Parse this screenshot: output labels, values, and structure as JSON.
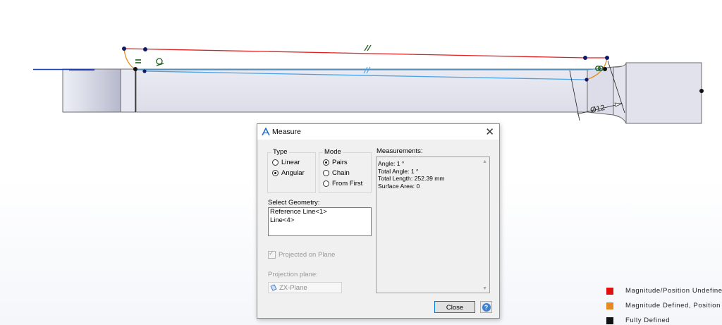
{
  "viewport": {
    "dimension_label": "Ø12",
    "colors": {
      "under_defined": "#e02020",
      "partially_defined": "#e58a20",
      "fully_defined": "#111111",
      "selected": "#4aa3e6",
      "reference_line": "#1f3fb0",
      "part_body": "#e4e5ee",
      "part_edge": "#555555"
    }
  },
  "dialog": {
    "title": "Measure",
    "title_icon": "measure-app-icon",
    "close_icon": "close-icon",
    "type_group": {
      "label": "Type",
      "options": [
        {
          "label": "Linear",
          "selected": false
        },
        {
          "label": "Angular",
          "selected": true
        }
      ]
    },
    "mode_group": {
      "label": "Mode",
      "options": [
        {
          "label": "Pairs",
          "selected": true
        },
        {
          "label": "Chain",
          "selected": false
        },
        {
          "label": "From First",
          "selected": false
        }
      ]
    },
    "select_geometry": {
      "label": "Select Geometry:",
      "items": [
        "Reference Line<1>",
        "Line<4>"
      ]
    },
    "projected_on_plane": {
      "label": "Projected on Plane",
      "checked": true,
      "enabled": false
    },
    "projection_plane": {
      "label": "Projection plane:",
      "value": "ZX-Plane",
      "icon": "plane-icon"
    },
    "measurements": {
      "label": "Measurements:",
      "lines": [
        "Angle: 1 °",
        "Total Angle: 1 °",
        "Total Length: 252.39 mm",
        "Surface Area:  0"
      ]
    },
    "close_button": "Close",
    "help_button": "?"
  },
  "legend": {
    "items": [
      {
        "label": "Magnitude/Position Undefined",
        "color": "#e01010"
      },
      {
        "label": "Magnitude Defined, Position Undefined",
        "color": "#e58a20"
      },
      {
        "label": "Fully Defined",
        "color": "#111111"
      }
    ]
  }
}
